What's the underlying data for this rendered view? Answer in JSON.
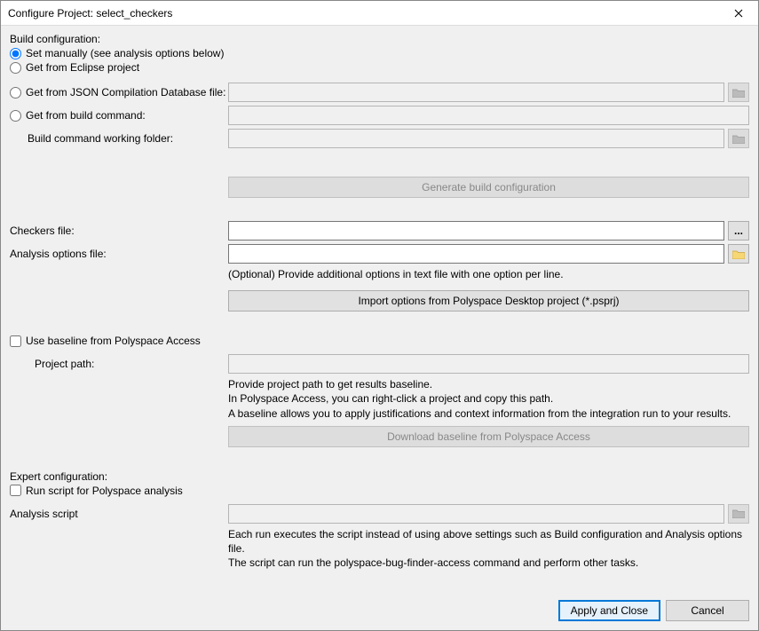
{
  "title": "Configure Project: select_checkers",
  "buildConfig": {
    "header": "Build configuration:",
    "opt_manual": "Set manually (see analysis options below)",
    "opt_eclipse": "Get from Eclipse project",
    "opt_json": "Get from JSON Compilation Database file:",
    "opt_buildcmd": "Get from build command:",
    "workingFolderLabel": "Build command working folder:",
    "generateButton": "Generate build configuration"
  },
  "checkers": {
    "label": "Checkers file:",
    "ellipsis": "..."
  },
  "analysisOptions": {
    "label": "Analysis options file:",
    "hint": "(Optional) Provide additional options in text file with one option per line.",
    "importButton": "Import options from Polyspace Desktop project (*.psprj)"
  },
  "baseline": {
    "check": "Use baseline from Polyspace Access",
    "projectPathLabel": "Project path:",
    "hint1": "Provide project path to get results baseline.",
    "hint2": " In Polyspace Access, you can right-click a project and copy this path.",
    "hint3": "A baseline allows you to apply justifications and context information from the integration run to your results.",
    "downloadButton": "Download baseline from Polyspace Access"
  },
  "expert": {
    "header": "Expert configuration:",
    "runScriptCheck": "Run script for Polyspace analysis",
    "scriptLabel": "Analysis script",
    "hint1": "Each run executes the script instead of using above settings such as Build configuration and Analysis options file.",
    "hint2": "The script can run the polyspace-bug-finder-access command and perform other tasks."
  },
  "footer": {
    "apply": "Apply and Close",
    "cancel": "Cancel"
  }
}
